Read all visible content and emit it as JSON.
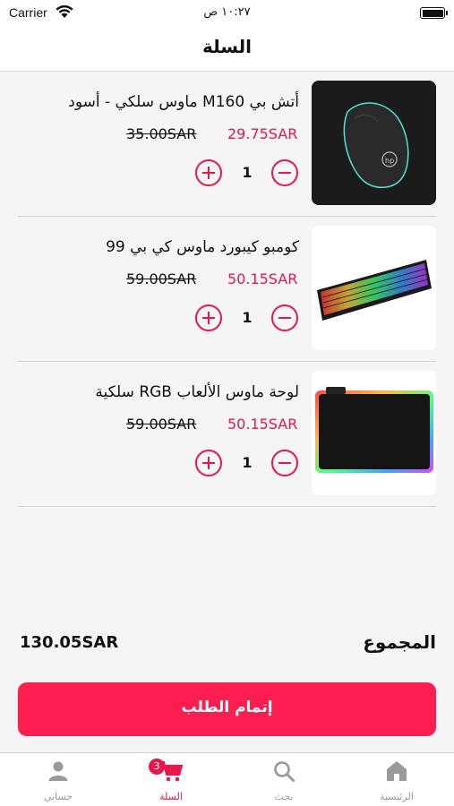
{
  "status_bar": {
    "carrier": "Carrier",
    "time": "١٠:٢٧ ص"
  },
  "header": {
    "title": "السلة"
  },
  "cart": {
    "items": [
      {
        "name": "أتش بي M160 ماوس سلكي - أسود",
        "price": "29.75SAR",
        "old_price": "35.00SAR",
        "quantity": "1",
        "image_icon": "hp-mouse-image"
      },
      {
        "name": "كومبو كيبورد ماوس كي بي 99",
        "price": "50.15SAR",
        "old_price": "59.00SAR",
        "quantity": "1",
        "image_icon": "rgb-keyboard-image"
      },
      {
        "name": "لوحة ماوس الألعاب RGB سلكية",
        "price": "50.15SAR",
        "old_price": "59.00SAR",
        "quantity": "1",
        "image_icon": "rgb-mousepad-image"
      }
    ]
  },
  "summary": {
    "total_label": "المجموع",
    "total_value": "130.05SAR"
  },
  "checkout": {
    "label": "إتمام الطلب"
  },
  "tab_bar": {
    "tabs": [
      {
        "label": "الرئيسية",
        "icon": "home-icon"
      },
      {
        "label": "بحث",
        "icon": "search-icon"
      },
      {
        "label": "السلة",
        "icon": "cart-icon",
        "badge": "3"
      },
      {
        "label": "حسابي",
        "icon": "user-icon"
      }
    ]
  },
  "colors": {
    "accent": "#e8174a",
    "button": "#fc1e4e"
  }
}
